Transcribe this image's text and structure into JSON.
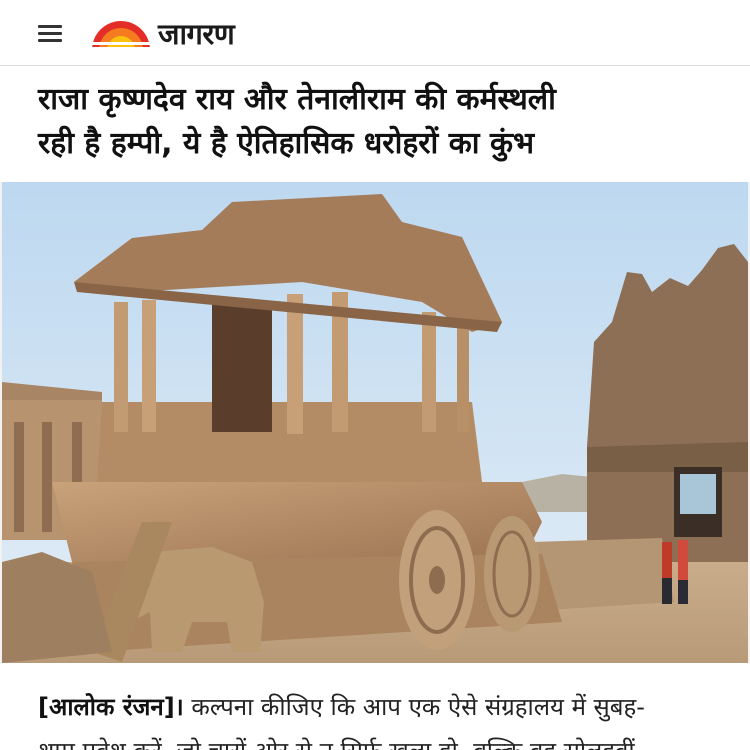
{
  "header": {
    "menu_icon": "hamburger-menu-icon",
    "logo_icon": "rising-sun-logo-icon",
    "logo_text": "जागरण",
    "logo_colors": {
      "sun_red": "#e52d27",
      "sun_orange": "#f47b20",
      "sun_yellow": "#fcc10f"
    }
  },
  "article": {
    "title_line1": "राजा कृष्णदेव राय और तेनालीराम की कर्मस्थली",
    "title_line2": "रही है हम्पी, ये है ऐतिहासिक धरोहरों का कुंभ",
    "hero_image": "hampi-stone-chariot-photo",
    "byline": "[आलोक रंजन]।",
    "body_line1": " कल्पना कीजिए कि आप एक ऐसे संग्रहालय में सुबह-",
    "body_line2": "शाम प्रवेश करें, जो चारों ओर से न सिर्फ खुला हो, बल्कि वह सोलहवीं"
  }
}
